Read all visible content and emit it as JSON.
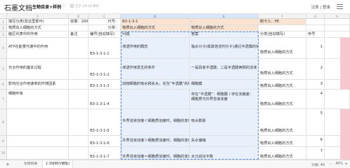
{
  "app": {
    "logo": "石墨文档",
    "doc_title": "生物目录+样例",
    "save_status": "已于 20:18 保存",
    "login_label": "注册 | 登录"
  },
  "columns": [
    "A",
    "B",
    "C",
    "D",
    "E",
    "F",
    "G",
    "H"
  ],
  "rows": [
    "1",
    "2",
    "3",
    "4",
    "5",
    "6",
    "7",
    "8",
    "9",
    "10"
  ],
  "cells": {
    "r1": {
      "a": "填写分类(改这里即可)",
      "b": "容量：200",
      "c": "代号：",
      "d": "B3-1-3-1",
      "e": "-",
      "f": "制卡人：PE"
    },
    "r2": {
      "a": "物质出入细胞的方式",
      "c": "分类：",
      "d": "物质出入细胞的方式",
      "e": "物质出入细胞的方式"
    },
    "r3": {
      "a": "脑区代表中的作用",
      "b": "备注",
      "c": "编号(自动填写)",
      "d": "问题",
      "e": "答案",
      "f": "分类(自动填写)",
      "g": "序号"
    },
    "r4": {
      "a": "ATP在能量代谢中的作用",
      "c": "B3-1-3-1-1",
      "d": "渗透作用的概念",
      "e": "指水分子(或其他溶剂分子)通过半透膜的扩散",
      "f": "物质出入细胞的方式",
      "g": "1"
    },
    "r5": {
      "a": "光合作用的基本过程",
      "c": "B3-1-3-1-2",
      "d": "渗透作用发生的条件",
      "e": "一是具有半透膜，二是半透膜两侧的溶液",
      "f": "物质出入细胞的方式",
      "g": "2"
    },
    "r6": {
      "a": "影响光合作用速率的环境因素",
      "c": "B3-1-3-1-3",
      "d": "动物细胞的吸水和失水，充当“半透膜”的结构",
      "e": "细胞膜",
      "f": "物质出入细胞的方式",
      "g": "3"
    },
    "r7": {
      "a": "细胞呼吸",
      "c": "B3-1-3-1-4",
      "e": "存在“半透膜”：细胞膜 / 存在浓度差：细胞质与外界溶液浓度",
      "f": "物质出入细胞的方式",
      "g": "4"
    },
    "r8": {
      "c": "B3-1-3-1-5",
      "d": "外界溶液浓度＜细胞质浓度时，细胞的变化",
      "e": "吸水膨胀",
      "f": "物质出入细胞的方式",
      "g": "5"
    },
    "r9": {
      "c": "B3-1-3-1-6",
      "d": "外界溶液浓度＞细胞质浓度时，细胞的变化",
      "e": "失水皱缩",
      "f": "物质出入细胞的方式",
      "g": "6"
    },
    "r10": {
      "c": "B3-1-3-1-7",
      "d": "外界溶液浓度＝细胞质浓度时，细胞的变化",
      "e": "水分进出平衡",
      "f": "物质出入细胞的方式",
      "g": "7"
    }
  },
  "bottom": {
    "add_sheet": "+",
    "tabs": [
      "生物目录",
      "1-3样例(V模板)"
    ],
    "count_label": "计数: 40",
    "zoom_minus": "-",
    "zoom": "40%",
    "zoom_plus": "+"
  }
}
